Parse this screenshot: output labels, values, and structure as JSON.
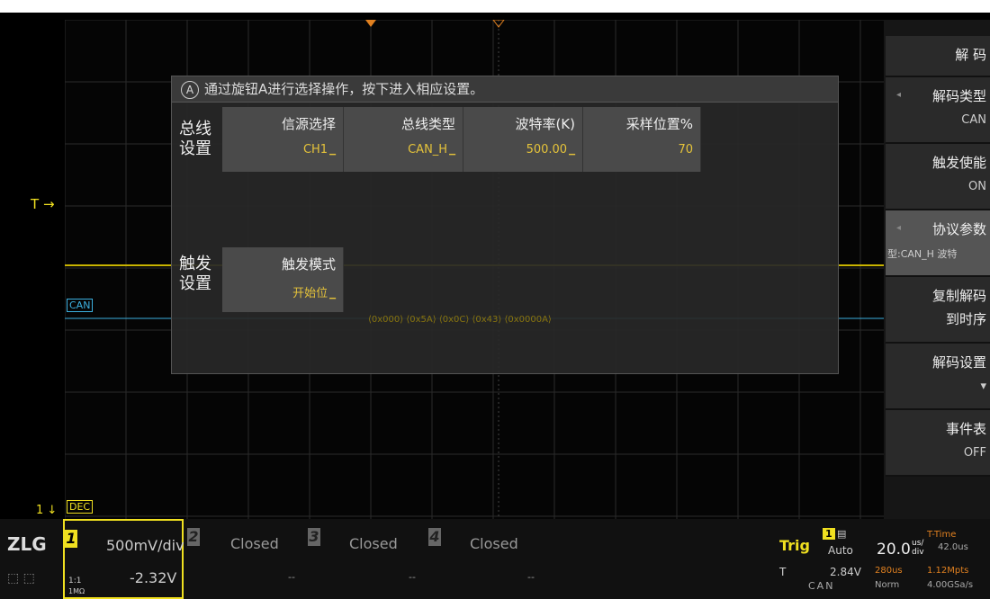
{
  "dialog": {
    "title": "通过旋钮A进行选择操作，按下进入相应设置。",
    "knob_letter": "A",
    "bus_label_1": "总线",
    "bus_label_2": "设置",
    "trig_label_1": "触发",
    "trig_label_2": "设置",
    "fields": [
      {
        "label": "信源选择",
        "value": "CH1"
      },
      {
        "label": "总线类型",
        "value": "CAN_H"
      },
      {
        "label": "波特率(K)",
        "value": "500.00"
      },
      {
        "label": "采样位置%",
        "value": "70"
      }
    ],
    "trigger_field": {
      "label": "触发模式",
      "value": "开始位"
    }
  },
  "menu": {
    "title": "解 码",
    "items": [
      {
        "label": "解码类型",
        "value": "CAN"
      },
      {
        "label": "触发使能",
        "value": "ON"
      },
      {
        "label": "协议参数",
        "value": "型:CAN_H 波特"
      },
      {
        "label": "复制解码",
        "label2": "到时序",
        "value": ""
      },
      {
        "label": "解码设置",
        "value": "▾"
      },
      {
        "label": "事件表",
        "value": "OFF"
      }
    ]
  },
  "waveform": {
    "trigger_marker": "T",
    "ch1_marker": "1",
    "can_tag": "CAN",
    "dec_tag": "DEC",
    "decode_frames": [
      "0x000",
      "0x5A",
      "0x0C",
      "0x43",
      "0x0000A"
    ]
  },
  "bottom": {
    "logo": "ZLG",
    "ch1": {
      "num": "1",
      "scale": "500mV/div",
      "offset": "-2.32V",
      "ratio": "1:1",
      "imp": "1MΩ"
    },
    "ch2": {
      "num": "2",
      "state": "Closed",
      "value": "--"
    },
    "ch3": {
      "num": "3",
      "state": "Closed",
      "value": "--"
    },
    "ch4": {
      "num": "4",
      "state": "Closed",
      "value": "--"
    },
    "trig": {
      "label": "Trig",
      "ch": "1",
      "mode": "Auto",
      "type": "T",
      "level": "2.84V",
      "bus": "CAN"
    },
    "time": {
      "scale": "20.0",
      "unit_top": "us/",
      "unit_bot": "div",
      "delay": "280us",
      "mode": "Norm",
      "ttime_label": "T-Time",
      "ttime": "42.0us",
      "points": "1.12Mpts",
      "rate": "4.00GSa/s"
    }
  },
  "colors": {
    "ch1": "#f0e020",
    "ch2": "#3cb0e0",
    "ch3": "#c040c0",
    "ch4": "#40c060",
    "accent": "#e5c33a"
  }
}
